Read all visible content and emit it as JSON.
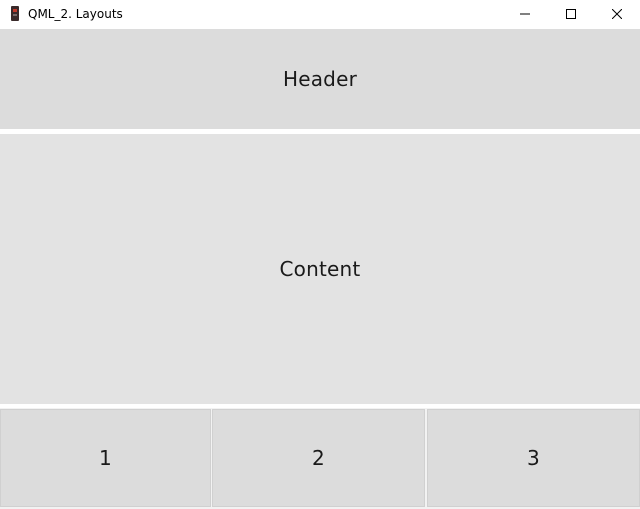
{
  "window": {
    "title": "QML_2. Layouts",
    "app_icon": "qml-app-icon",
    "controls": {
      "minimize_icon": "minimize-icon",
      "maximize_icon": "maximize-icon",
      "close_icon": "close-icon"
    }
  },
  "layout": {
    "header_label": "Header",
    "content_label": "Content",
    "footer_buttons": [
      {
        "label": "1"
      },
      {
        "label": "2"
      },
      {
        "label": "3"
      }
    ]
  },
  "colors": {
    "header_bg": "#dcdcdc",
    "content_bg": "#e3e3e3",
    "button_bg": "#dcdcdc",
    "text": "#1a1a1a"
  }
}
